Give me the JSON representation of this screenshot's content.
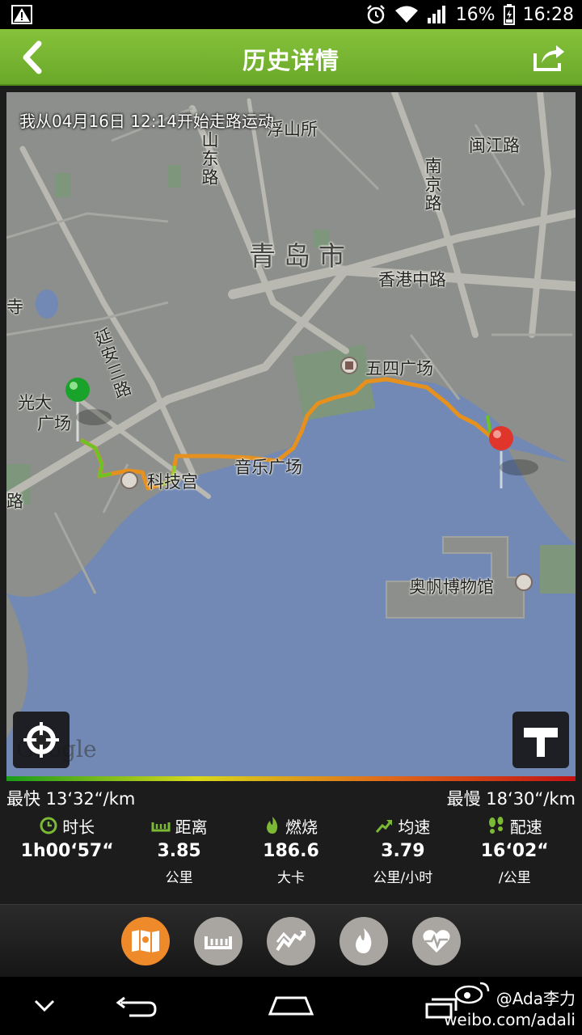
{
  "status_bar": {
    "battery": "16%",
    "time": "16:28"
  },
  "header": {
    "title": "历史详情",
    "back_icon": "chevron-left-icon",
    "share_icon": "share-icon"
  },
  "map": {
    "start_caption": "我从04月16日 12:14开始走路运动",
    "labels": {
      "fushan": "浮山所",
      "shandong_road": "山东路",
      "minjiang_road": "闽江路",
      "nanjing_road": "南京路",
      "city": "青岛市",
      "hongkong_road": "香港中路",
      "temple": "寺",
      "yanan_road": "延安三路",
      "may_fourth_square": "五四广场",
      "everbright_square_1": "光大",
      "everbright_square_2": "广场",
      "road_left": "路",
      "tech_palace": "科技宫",
      "music_square": "音乐广场",
      "sailing_museum": "奥帆博物馆",
      "google": "Google"
    },
    "start_pin_color": "#1aa32a",
    "end_pin_color": "#e0352a",
    "water_color": "#7289b5"
  },
  "speed": {
    "fastest": "最快 13‘32“/km",
    "slowest": "最慢 18‘30“/km"
  },
  "stats": [
    {
      "label": "时长",
      "value": "1h00‘57“",
      "unit": "",
      "icon": "clock-icon"
    },
    {
      "label": "距离",
      "value": "3.85",
      "unit": "公里",
      "icon": "ruler-icon"
    },
    {
      "label": "燃烧",
      "value": "186.6",
      "unit": "大卡",
      "icon": "flame-icon"
    },
    {
      "label": "均速",
      "value": "3.79",
      "unit": "公里/小时",
      "icon": "trend-up-icon"
    },
    {
      "label": "配速",
      "value": "16‘02“",
      "unit": "/公里",
      "icon": "footprints-icon"
    }
  ],
  "tabs": [
    {
      "icon": "map-icon",
      "active": true
    },
    {
      "icon": "ruler-icon",
      "active": false
    },
    {
      "icon": "speed-chart-icon",
      "active": false
    },
    {
      "icon": "flame-icon",
      "active": false
    },
    {
      "icon": "heart-rate-icon",
      "active": false
    }
  ],
  "watermark": {
    "line1": "@Ada李力",
    "line2": "weibo.com/adali"
  },
  "accent_color": "#7cb934"
}
